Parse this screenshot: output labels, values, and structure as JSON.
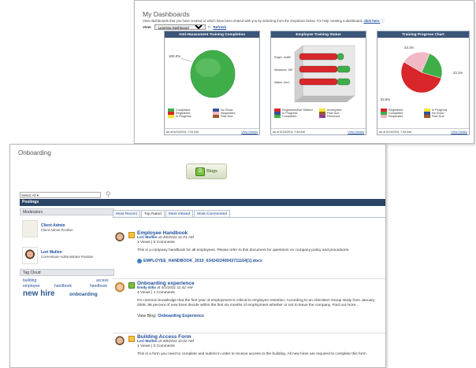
{
  "dashboards": {
    "title": "My Dashboards",
    "description": "View dashboards that you have created or which have been shared with you by selecting from the dropdown below. For help creating a dashboard,",
    "help_link": "click here.",
    "view_label": "View:",
    "view_value": "Learning Dashboard",
    "refresh_label": "Refresh",
    "panels": [
      {
        "title": "Anti-Harassment Training Completion",
        "date": "as of 6/24/2011 7:34 AM",
        "view_details": "View Details",
        "legend": [
          {
            "label": "Completed",
            "color": "#3fae49"
          },
          {
            "label": "No Show",
            "color": "#3a4f9c"
          },
          {
            "label": "Registered",
            "color": "#d8262b"
          },
          {
            "label": "Requested",
            "color": "#f2b8c6"
          },
          {
            "label": "In Progress",
            "color": "#f2e53b"
          },
          {
            "label": "Past Due",
            "color": "#9b5b2b"
          }
        ]
      },
      {
        "title": "Employee Training Status",
        "date": "as of 6/24/2011 7:34 AM",
        "view_details": "View Details",
        "legend": [
          {
            "label": "Registered/Not Started",
            "color": "#d8262b"
          },
          {
            "label": "Incomplete",
            "color": "#f2e53b"
          },
          {
            "label": "In Progress",
            "color": "#3a4f9c"
          },
          {
            "label": "Past Due",
            "color": "#9b5b2b"
          },
          {
            "label": "Completed",
            "color": "#3fae49"
          },
          {
            "label": "Removed",
            "color": "#8e3c96"
          }
        ]
      },
      {
        "title": "Training Progress Chart",
        "date": "as of 6/24/2011 7:34 AM",
        "view_details": "View Details",
        "legend": [
          {
            "label": "Registered",
            "color": "#d8262b"
          },
          {
            "label": "In Progress",
            "color": "#f2e53b"
          },
          {
            "label": "Completed",
            "color": "#3fae49"
          },
          {
            "label": "No Show",
            "color": "#3a4f9c"
          },
          {
            "label": "Requested",
            "color": "#f2b8c6"
          },
          {
            "label": "Past Due",
            "color": "#9b5b2b"
          }
        ]
      }
    ]
  },
  "chart_data": [
    {
      "type": "pie",
      "title": "Anti-Harassment Training Completion",
      "slices": [
        {
          "label": "Completed",
          "value": 100.0
        }
      ],
      "slice_labels": [
        "100.0%"
      ]
    },
    {
      "type": "bar",
      "title": "Employee Training Status",
      "categories": [
        "Roger, Judith",
        "Meadows, Jeff",
        "Waller, Kerri"
      ],
      "series": [
        {
          "name": "Registered/Not Started",
          "values": [
            3,
            3,
            3
          ]
        },
        {
          "name": "Completed",
          "values": [
            0.5,
            1,
            1
          ]
        }
      ]
    },
    {
      "type": "pie",
      "title": "Training Progress Chart",
      "slices": [
        {
          "label": "Registered",
          "value": 53.8
        },
        {
          "label": "Requested",
          "value": 23.1
        },
        {
          "label": "Completed",
          "value": 23.1
        }
      ],
      "slice_labels": [
        "53.8%",
        "23.1%",
        "23.1%"
      ]
    }
  ],
  "onboarding": {
    "title": "Onboarding",
    "blogs_label": "Blogs",
    "select_value": "Select All",
    "postings_label": "Postings",
    "moderators_label": "Moderators",
    "moderators": [
      {
        "name": "Client Admin",
        "role": "Client Admin Position"
      },
      {
        "name": "Lori Mullen",
        "role": "Cornerstone Administrator Position"
      }
    ],
    "tag_cloud_label": "Tag Cloud",
    "tags": [
      "building",
      "access",
      "employee",
      "handbook",
      "handbook",
      "new hire",
      "onboarding"
    ],
    "tabs": [
      "Most Recent",
      "Top Rated",
      "Most Viewed",
      "Most Commented"
    ],
    "posts": [
      {
        "title": "Employee Handbook",
        "author": "Lori Mullen",
        "when": "at 4/6/2011 11:01 AM",
        "counts": "1 Views  |  0 Comments",
        "text": "This is a company handbook for all employees. Please refer to this document for questions on company policy and procedures.",
        "attachment": "EMPLOYEE_HANDBOOK_2010_634242240043711164[1].docx"
      },
      {
        "title": "Onboarding experience",
        "author": "Emily Ellis",
        "when": "at 4/1/2011 11:42 AM",
        "counts": "4 Views  |  1 Comments",
        "text": "It's common knowledge that the first year of employment is critical to employee retention. According to an Aberdeen Group study from January 2008, 86 percent of new hires decide within the first six months of employment whether or not to leave the company. Find out more...",
        "view_blog_label": "View Blog:",
        "view_blog": "Onboarding Experience"
      },
      {
        "title": "Building Access Form",
        "author": "Lori Mullen",
        "when": "at 4/8/2011 11:02 AM",
        "counts": "1 Views  |  0 Comments",
        "text": "This is a form you need to complete and submit in order to receive access to the building. All new hires are required to complete this form."
      }
    ]
  }
}
